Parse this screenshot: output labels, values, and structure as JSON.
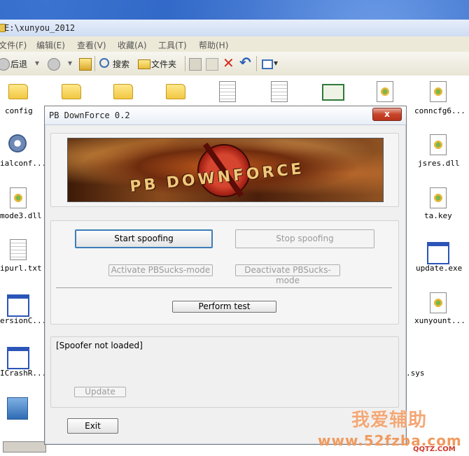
{
  "explorer": {
    "title": "E:\\xunyou_2012",
    "menu": [
      "文件(F)",
      "编辑(E)",
      "查看(V)",
      "收藏(A)",
      "工具(T)",
      "帮助(H)"
    ],
    "toolbar": {
      "back_label": "后退",
      "search_label": "搜索",
      "folders_label": "文件夹"
    },
    "files": {
      "config": "config",
      "connect": "conncfg6...",
      "serial": "ialconf...",
      "jsres": "jsres.dll",
      "mode3": "mode3.dll",
      "tkey": "ta.key",
      "ipurl": "ipurl.txt",
      "update": "update.exe",
      "version": "ersionC...",
      "xunyount": "xunyount...",
      "crash": "ICrashR...",
      "sys": ".sys"
    }
  },
  "dialog": {
    "title": "PB DownForce 0.2",
    "close_label": "x",
    "banner_text": "PB DOWNFORCE",
    "buttons": {
      "start": "Start spoofing",
      "stop": "Stop spoofing",
      "activate": "Activate PBSucks-mode",
      "deactivate": "Deactivate PBSucks-mode",
      "perform": "Perform test",
      "update": "Update",
      "exit": "Exit"
    },
    "status": "[Spoofer not loaded]"
  },
  "watermark": {
    "line1": "我爱辅助",
    "line2": "www.52fzba.com",
    "line3": "QQTZ.COM"
  }
}
